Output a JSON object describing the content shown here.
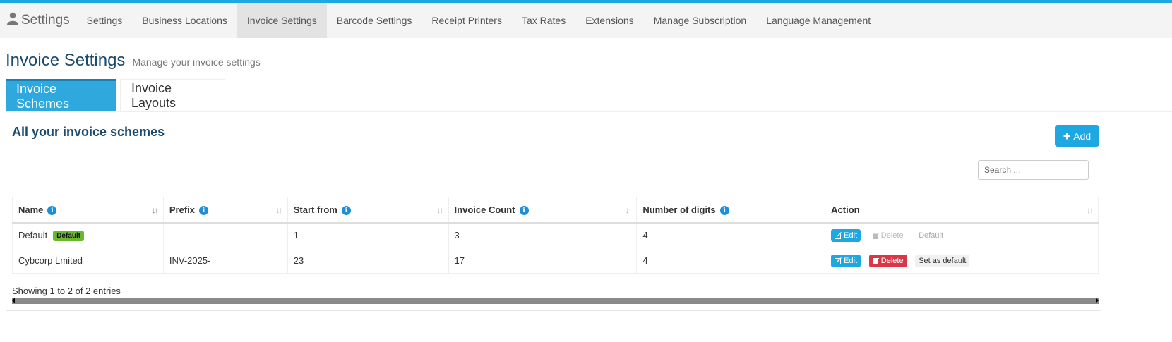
{
  "navbar": {
    "brand": "Settings",
    "items": [
      {
        "label": "Settings",
        "active": false
      },
      {
        "label": "Business Locations",
        "active": false
      },
      {
        "label": "Invoice Settings",
        "active": true
      },
      {
        "label": "Barcode Settings",
        "active": false
      },
      {
        "label": "Receipt Printers",
        "active": false
      },
      {
        "label": "Tax Rates",
        "active": false
      },
      {
        "label": "Extensions",
        "active": false
      },
      {
        "label": "Manage Subscription",
        "active": false
      },
      {
        "label": "Language Management",
        "active": false
      }
    ]
  },
  "page": {
    "title": "Invoice Settings",
    "subtitle": "Manage your invoice settings"
  },
  "tabs": [
    {
      "label": "Invoice Schemes",
      "active": true
    },
    {
      "label": "Invoice Layouts",
      "active": false
    }
  ],
  "box": {
    "title": "All your invoice schemes",
    "add_label": "Add",
    "search_placeholder": "Search ..."
  },
  "table": {
    "columns": [
      {
        "label": "Name",
        "info": true
      },
      {
        "label": "Prefix",
        "info": true
      },
      {
        "label": "Start from",
        "info": true
      },
      {
        "label": "Invoice Count",
        "info": true
      },
      {
        "label": "Number of digits",
        "info": true
      },
      {
        "label": "Action",
        "info": false
      }
    ],
    "rows": [
      {
        "name": "Default",
        "badge": "Default",
        "prefix": "",
        "start_from": "1",
        "invoice_count": "3",
        "digits": "4",
        "actions": {
          "edit": "Edit",
          "delete": "Delete",
          "default": "Default"
        }
      },
      {
        "name": "Cybcorp Lmited",
        "badge": "",
        "prefix": "INV-2025-",
        "start_from": "23",
        "invoice_count": "17",
        "digits": "4",
        "actions": {
          "edit": "Edit",
          "delete": "Delete",
          "default": "Set as default"
        }
      }
    ],
    "footer": "Showing 1 to 2 of 2 entries"
  },
  "colors": {
    "accent": "#1ea7e1",
    "title": "#1c4b6e",
    "danger": "#dc3545",
    "success": "#6ab830"
  }
}
